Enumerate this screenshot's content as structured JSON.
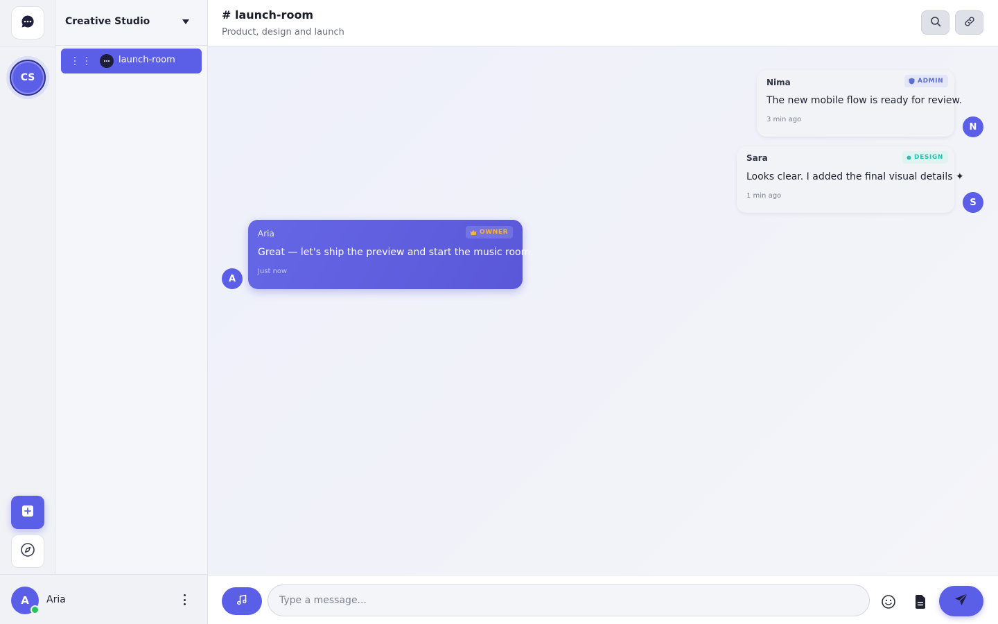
{
  "rail": {
    "home_icon": "chat-bubble-icon",
    "server_initials": "CS",
    "add_icon": "plus-square-icon",
    "explore_icon": "compass-icon"
  },
  "server": {
    "name": "Creative Studio",
    "menu_icon": "caret-down-icon"
  },
  "channels": [
    {
      "name": "launch-room",
      "icon": "chat-bubble-icon",
      "active": true
    }
  ],
  "user": {
    "initial": "A",
    "name": "Aria",
    "status": "online",
    "menu_icon": "vertical-dots-icon"
  },
  "header": {
    "title": "# launch-room",
    "subtitle": "Product, design and launch",
    "search_icon": "search-icon",
    "link_icon": "link-icon"
  },
  "messages": [
    {
      "author": "Nima",
      "badge": "ADMIN",
      "badge_icon": "shield-icon",
      "text": "The new mobile flow is ready for review.",
      "time": "3 min ago",
      "avatar": "N",
      "own": false
    },
    {
      "author": "Sara",
      "badge": "DESIGN",
      "badge_icon": "dot-icon",
      "text": "Looks clear. I added the final visual details ✦",
      "time": "1 min ago",
      "avatar": "S",
      "own": false
    },
    {
      "author": "Aria",
      "badge": "OWNER",
      "badge_icon": "crown-icon",
      "text": "Great — let's ship the preview and start the music room.",
      "time": "Just now",
      "avatar": "A",
      "own": true
    }
  ],
  "composer": {
    "placeholder": "Type a message...",
    "value": "",
    "music_icon": "music-note-icon",
    "emoji_icon": "smiley-icon",
    "file_icon": "file-icon",
    "send_icon": "send-icon"
  },
  "colors": {
    "accent": "#5b5ee6",
    "online": "#22c55e",
    "admin_badge": "#5a6fd0",
    "design_badge": "#2cc0b0",
    "owner_badge": "#f5b43f"
  }
}
